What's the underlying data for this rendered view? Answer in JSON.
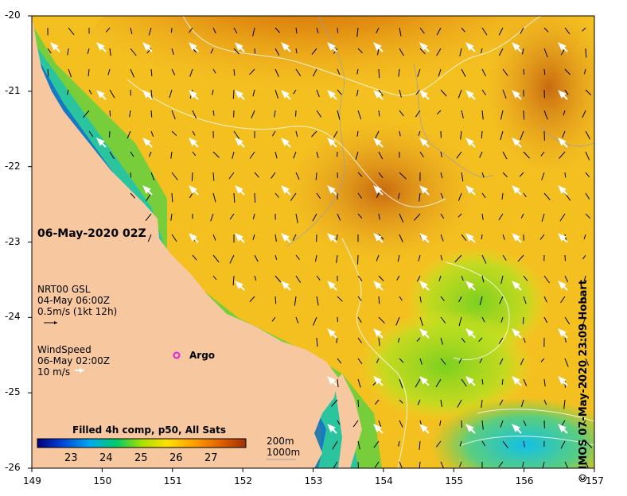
{
  "title": "06-May-2020 02Z",
  "x_ticks": [
    "149",
    "150",
    "151",
    "152",
    "153",
    "154",
    "155",
    "156",
    "157"
  ],
  "y_ticks": [
    "-20",
    "-21",
    "-22",
    "-23",
    "-24",
    "-25",
    "-26"
  ],
  "current_legend": {
    "line1": "NRT00 GSL",
    "line2": "04-May 06:00Z",
    "line3": "0.5m/s (1kt 12h)"
  },
  "wind_legend": {
    "line1": "WindSpeed",
    "line2": "06-May 02:00Z",
    "line3": "10 m/s"
  },
  "argo_label": "Argo",
  "colorbar": {
    "title": "Filled 4h comp, p50, All Sats",
    "labels": [
      "23",
      "24",
      "25",
      "26",
      "27"
    ],
    "colors": [
      "#00007a",
      "#0044d8",
      "#00a8f0",
      "#00cc66",
      "#a8e000",
      "#ffe000",
      "#ffa000",
      "#e06000",
      "#a03000"
    ]
  },
  "depth_legend": {
    "line1": "200m",
    "line2": "1000m"
  },
  "credit": "© IMOS 07-May-2020 23:09 Hobart"
}
